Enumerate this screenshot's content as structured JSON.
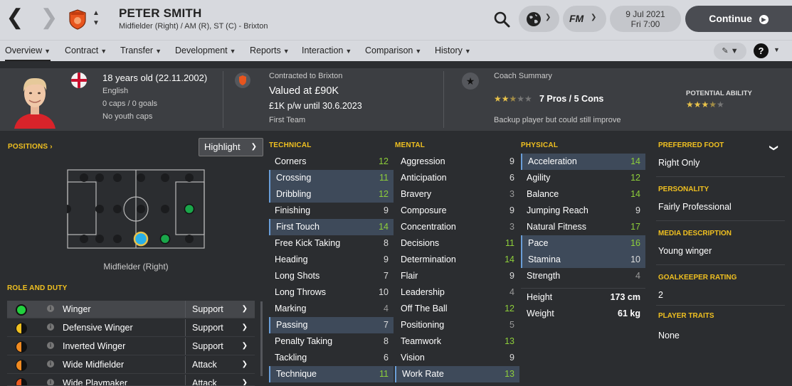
{
  "header": {
    "name": "PETER SMITH",
    "subtitle": "Midfielder (Right) / AM (R), ST (C) - Brixton",
    "date": "9 Jul 2021",
    "time": "Fri 7:00",
    "continue_label": "Continue"
  },
  "tabs": [
    {
      "label": "Overview"
    },
    {
      "label": "Contract"
    },
    {
      "label": "Transfer"
    },
    {
      "label": "Development"
    },
    {
      "label": "Reports"
    },
    {
      "label": "Interaction"
    },
    {
      "label": "Comparison"
    },
    {
      "label": "History"
    }
  ],
  "profile": {
    "age": "18 years old (22.11.2002)",
    "nationality": "English",
    "caps": "0 caps / 0 goals",
    "youth_caps": "No youth caps",
    "contract_line": "Contracted to Brixton",
    "value": "Valued at £90K",
    "wage": "£1K p/w until 30.6.2023",
    "squad_status": "First Team",
    "coach_title": "Coach Summary",
    "coach_rating_stars": 2.5,
    "pros_cons": "7 Pros / 5 Cons",
    "coach_comment": "Backup player but could still improve",
    "potential_title": "POTENTIAL ABILITY",
    "potential_stars": 3.5
  },
  "positions": {
    "title": "POSITIONS",
    "highlight_label": "Highlight",
    "position_name": "Midfielder (Right)"
  },
  "roles": {
    "title": "ROLE AND DUTY",
    "items": [
      {
        "name": "Winger",
        "duty": "Support",
        "rating": "natural"
      },
      {
        "name": "Defensive Winger",
        "duty": "Support",
        "rating": "half"
      },
      {
        "name": "Inverted Winger",
        "duty": "Support",
        "rating": "half"
      },
      {
        "name": "Wide Midfielder",
        "duty": "Attack",
        "rating": "half"
      },
      {
        "name": "Wide Playmaker",
        "duty": "Attack",
        "rating": "half"
      }
    ]
  },
  "technical": {
    "title": "TECHNICAL",
    "attrs": [
      {
        "name": "Corners",
        "value": "12",
        "hl": false
      },
      {
        "name": "Crossing",
        "value": "11",
        "hl": true
      },
      {
        "name": "Dribbling",
        "value": "12",
        "hl": true
      },
      {
        "name": "Finishing",
        "value": "9",
        "hl": false
      },
      {
        "name": "First Touch",
        "value": "14",
        "hl": true
      },
      {
        "name": "Free Kick Taking",
        "value": "8",
        "hl": false
      },
      {
        "name": "Heading",
        "value": "9",
        "hl": false
      },
      {
        "name": "Long Shots",
        "value": "7",
        "hl": false
      },
      {
        "name": "Long Throws",
        "value": "10",
        "hl": false
      },
      {
        "name": "Marking",
        "value": "4",
        "hl": false
      },
      {
        "name": "Passing",
        "value": "7",
        "hl": true
      },
      {
        "name": "Penalty Taking",
        "value": "8",
        "hl": false
      },
      {
        "name": "Tackling",
        "value": "6",
        "hl": false
      },
      {
        "name": "Technique",
        "value": "11",
        "hl": true
      }
    ]
  },
  "mental": {
    "title": "MENTAL",
    "attrs": [
      {
        "name": "Aggression",
        "value": "9",
        "hl": false
      },
      {
        "name": "Anticipation",
        "value": "6",
        "hl": false
      },
      {
        "name": "Bravery",
        "value": "3",
        "hl": false
      },
      {
        "name": "Composure",
        "value": "9",
        "hl": false
      },
      {
        "name": "Concentration",
        "value": "3",
        "hl": false
      },
      {
        "name": "Decisions",
        "value": "11",
        "hl": false
      },
      {
        "name": "Determination",
        "value": "14",
        "hl": false
      },
      {
        "name": "Flair",
        "value": "9",
        "hl": false
      },
      {
        "name": "Leadership",
        "value": "4",
        "hl": false
      },
      {
        "name": "Off The Ball",
        "value": "12",
        "hl": false
      },
      {
        "name": "Positioning",
        "value": "5",
        "hl": false
      },
      {
        "name": "Teamwork",
        "value": "13",
        "hl": false
      },
      {
        "name": "Vision",
        "value": "9",
        "hl": false
      },
      {
        "name": "Work Rate",
        "value": "13",
        "hl": true
      }
    ]
  },
  "physical": {
    "title": "PHYSICAL",
    "attrs": [
      {
        "name": "Acceleration",
        "value": "14",
        "hl": true
      },
      {
        "name": "Agility",
        "value": "12",
        "hl": false
      },
      {
        "name": "Balance",
        "value": "14",
        "hl": false
      },
      {
        "name": "Jumping Reach",
        "value": "9",
        "hl": false
      },
      {
        "name": "Natural Fitness",
        "value": "17",
        "hl": false
      },
      {
        "name": "Pace",
        "value": "16",
        "hl": true
      },
      {
        "name": "Stamina",
        "value": "10",
        "hl": true
      },
      {
        "name": "Strength",
        "value": "4",
        "hl": false
      }
    ],
    "height_label": "Height",
    "height_value": "173 cm",
    "weight_label": "Weight",
    "weight_value": "61 kg"
  },
  "info": {
    "foot_title": "PREFERRED FOOT",
    "foot": "Right Only",
    "personality_title": "PERSONALITY",
    "personality": "Fairly Professional",
    "media_title": "MEDIA DESCRIPTION",
    "media": "Young winger",
    "gk_title": "GOALKEEPER RATING",
    "gk": "2",
    "traits_title": "PLAYER TRAITS",
    "traits": "None"
  }
}
